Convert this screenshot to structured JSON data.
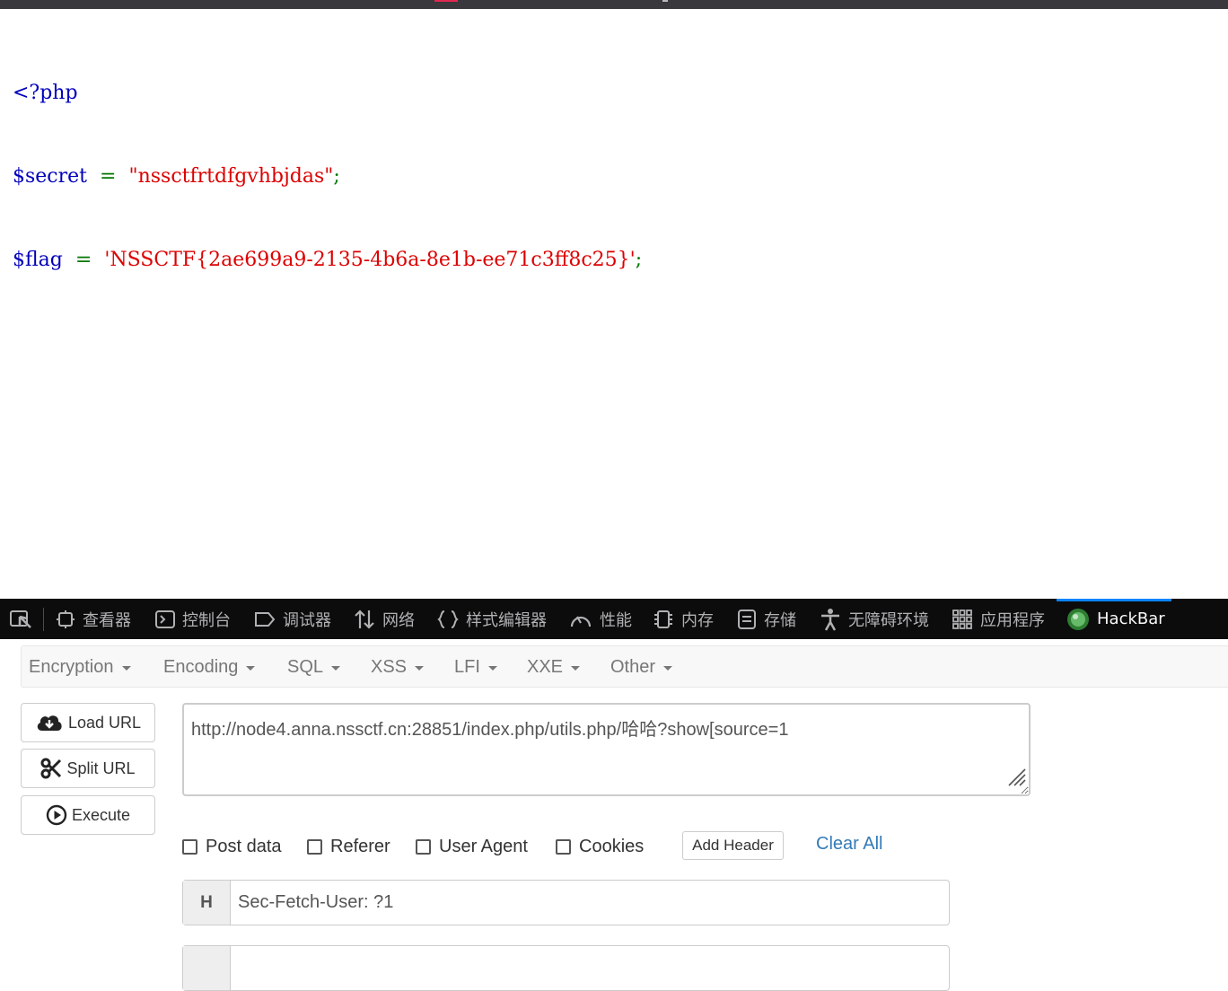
{
  "source_code": {
    "line1": {
      "open_tag": "<?php"
    },
    "line2": {
      "var": "$secret",
      "op": "=",
      "value": "\"nssctfrtdfgvhbjdas\"",
      "end": ";"
    },
    "line3": {
      "var": "$flag",
      "op": "=",
      "value": "'NSSCTF{2ae699a9-2135-4b6a-8e1b-ee71c3ff8c25}'",
      "end": ";"
    },
    "colors": {
      "keyword": "#0000bb",
      "operator": "#007700",
      "string": "#dd0000"
    }
  },
  "devtools": {
    "tabs": [
      {
        "label": "查看器",
        "icon": "inspector-icon"
      },
      {
        "label": "控制台",
        "icon": "console-icon"
      },
      {
        "label": "调试器",
        "icon": "debugger-icon"
      },
      {
        "label": "网络",
        "icon": "network-icon"
      },
      {
        "label": "样式编辑器",
        "icon": "style-editor-icon"
      },
      {
        "label": "性能",
        "icon": "performance-icon"
      },
      {
        "label": "内存",
        "icon": "memory-icon"
      },
      {
        "label": "存储",
        "icon": "storage-icon"
      },
      {
        "label": "无障碍环境",
        "icon": "accessibility-icon"
      },
      {
        "label": "应用程序",
        "icon": "application-icon"
      },
      {
        "label": "HackBar",
        "icon": "hackbar-logo-icon",
        "active": true
      }
    ],
    "active_color": "#0a84ff"
  },
  "hackbar": {
    "menu": [
      "Encryption",
      "Encoding",
      "SQL",
      "XSS",
      "LFI",
      "XXE",
      "Other"
    ],
    "buttons": {
      "load_url": "Load URL",
      "split_url": "Split URL",
      "execute": "Execute"
    },
    "url": "http://node4.anna.nssctf.cn:28851/index.php/utils.php/哈哈?show[source=1",
    "options": {
      "post_data": "Post data",
      "referer": "Referer",
      "user_agent": "User Agent",
      "cookies": "Cookies"
    },
    "add_header": "Add Header",
    "clear_all": "Clear All",
    "headers": [
      {
        "addon": "H",
        "value": "Sec-Fetch-User: ?1"
      },
      {
        "addon": "",
        "value": ""
      }
    ]
  }
}
